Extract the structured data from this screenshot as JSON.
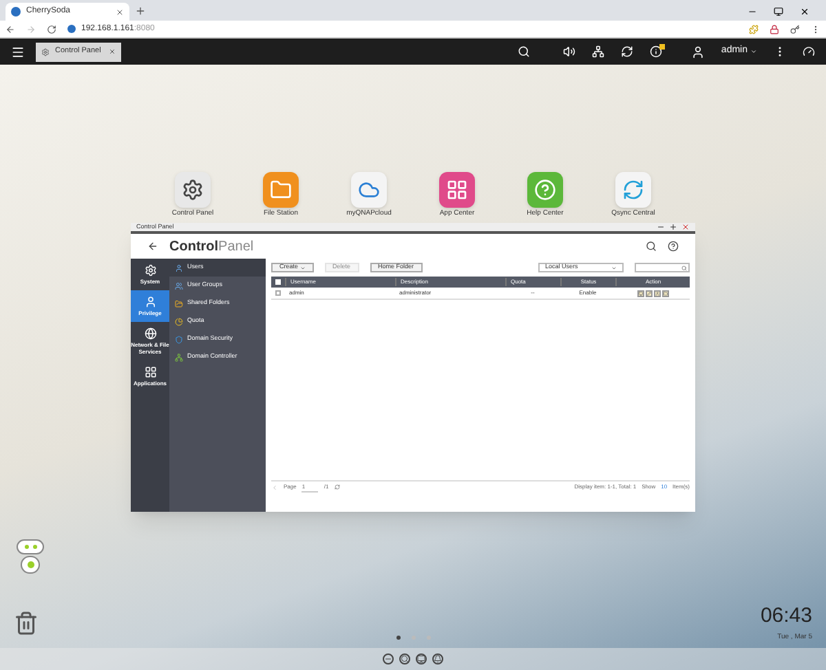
{
  "browser": {
    "tab_title": "CherrySoda",
    "url_host": "192.168.1.161",
    "url_port": ":8080"
  },
  "top_bar": {
    "open_app": "Control Panel",
    "user": "admin"
  },
  "desktop_apps": [
    "Control Panel",
    "File Station",
    "myQNAPcloud",
    "App Center",
    "Help Center",
    "Qsync Central"
  ],
  "window": {
    "title": "Control Panel",
    "heading_bold": "Control",
    "heading_light": "Panel",
    "nav": [
      {
        "label": "System",
        "selected": false
      },
      {
        "label": "Privilege",
        "selected": true
      },
      {
        "label": "Network & File Services",
        "selected": false
      },
      {
        "label": "Applications",
        "selected": false
      }
    ],
    "submenu": [
      {
        "label": "Users",
        "selected": true
      },
      {
        "label": "User Groups",
        "selected": false
      },
      {
        "label": "Shared Folders",
        "selected": false
      },
      {
        "label": "Quota",
        "selected": false
      },
      {
        "label": "Domain Security",
        "selected": false
      },
      {
        "label": "Domain Controller",
        "selected": false
      }
    ],
    "toolbar": [
      {
        "label": "Create",
        "disabled": false,
        "dropdown": true
      },
      {
        "label": "Delete",
        "disabled": true,
        "dropdown": false
      },
      {
        "label": "Home Folder",
        "disabled": false,
        "dropdown": false
      }
    ],
    "user_filter": "Local Users",
    "table": {
      "all_checked": false,
      "columns": [
        "Username",
        "Description",
        "Quota",
        "Status",
        "Action"
      ],
      "rows": [
        {
          "checked": false,
          "cells": [
            "admin",
            "administrator",
            "--",
            "Enable"
          ]
        }
      ]
    },
    "pager": {
      "page_label": "Page",
      "page": "1",
      "page_total": "/1",
      "display": "Display item: 1-1, Total: 1",
      "show_label": "Show",
      "show_value": "10",
      "items_label": "Item(s)"
    }
  },
  "page_dots": [
    {
      "selected": true
    },
    {
      "selected": false
    },
    {
      "selected": false
    }
  ],
  "clock": {
    "time": "06:43",
    "date": "Tue , Mar 5"
  }
}
